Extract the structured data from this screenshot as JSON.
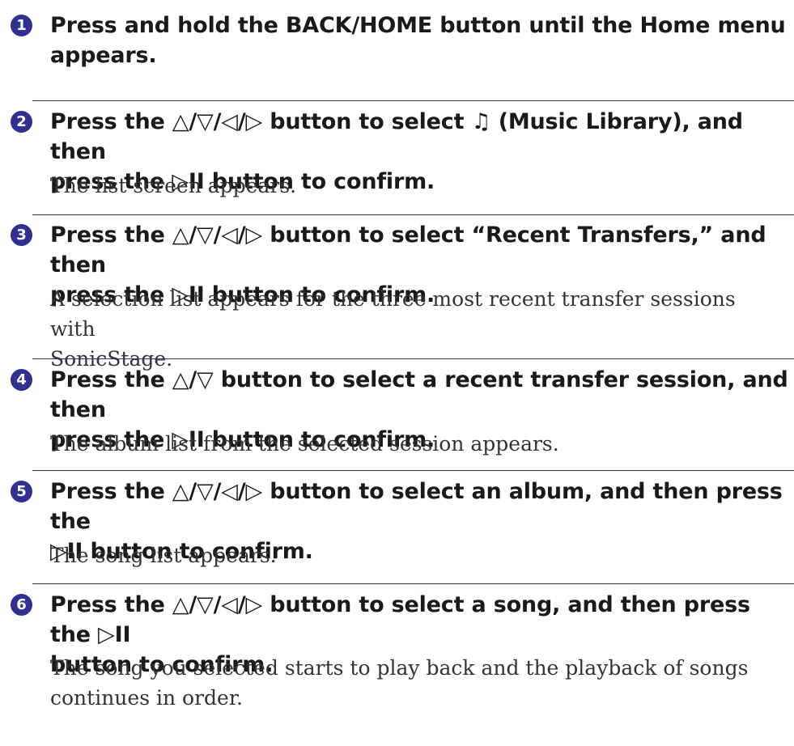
{
  "colors": {
    "accent": "#2e3192",
    "divider": "#2b2e7a",
    "text": "#1a1a1a"
  },
  "steps": [
    {
      "number": "1",
      "heading_line1": "Press and hold the BACK/HOME button until the Home menu",
      "heading_line2": "appears."
    },
    {
      "number": "2",
      "heading_line1": "Press the △/▽/◁/▷ button to select ♫ (Music Library), and then",
      "heading_line2": "press the ▷II button to confirm.",
      "music_library_icon": "music-note-icon",
      "description": "The list screen appears."
    },
    {
      "number": "3",
      "heading_line1": "Press the △/▽/◁/▷ button to select “Recent Transfers,” and then",
      "heading_line2": "press the ▷II button to confirm.",
      "description_line1": "A selection list appears for the three most recent transfer sessions with",
      "description_line2": "SonicStage."
    },
    {
      "number": "4",
      "heading_line1": "Press the △/▽ button to select a recent transfer session, and then",
      "heading_line2": "press the ▷II button to confirm.",
      "description": "The album list from the selected session appears."
    },
    {
      "number": "5",
      "heading_line1": "Press the △/▽/◁/▷ button to select an album, and then press the",
      "heading_line2": "▷II button to confirm.",
      "description": "The song list appears."
    },
    {
      "number": "6",
      "heading_line1": "Press the △/▽/◁/▷ button to select a song, and then press the ▷II",
      "heading_line2": "button to confirm.",
      "description_line1": "The song you selected starts to play back and the playback of songs",
      "description_line2": "continues in order."
    }
  ]
}
